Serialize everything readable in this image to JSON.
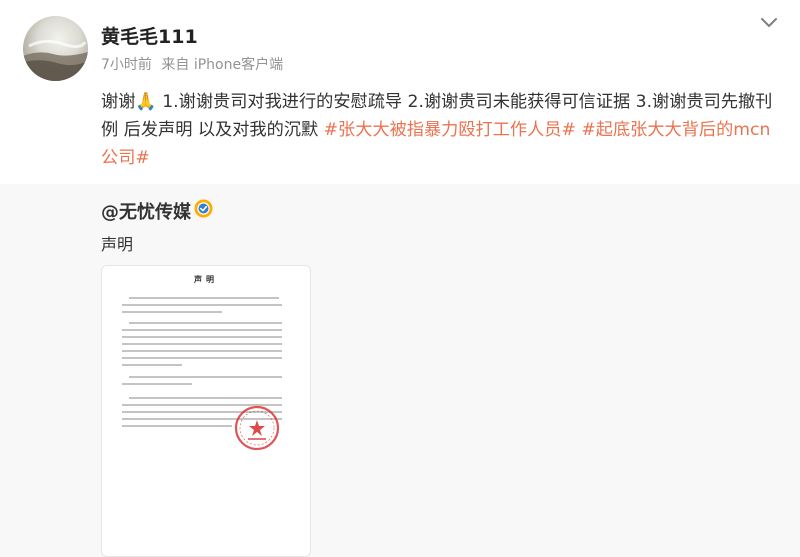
{
  "author": {
    "name": "黄毛毛111",
    "time": "7小时前",
    "source": "来自 iPhone客户端"
  },
  "post": {
    "text_before": "谢谢🙏 1.谢谢贵司对我进行的安慰疏导 2.谢谢贵司未能获得可信证据 3.谢谢贵司先撤刊例 后发声明 以及对我的沉默 ",
    "hashtag_1": "#张大大被指暴力殴打工作人员#",
    "hashtag_2": "#起底张大大背后的mcn公司#"
  },
  "repost": {
    "user": "@无忧传媒",
    "text": "声明",
    "document": {
      "title": "声明"
    }
  },
  "icons": {
    "more": "chevron-down-icon",
    "verified": "verified-badge-icon",
    "seal": "company-seal"
  },
  "colors": {
    "hashtag": "#eb7350",
    "verified": "#ffab00",
    "seal": "#d93636",
    "repost_bg": "#f8f8f8"
  }
}
